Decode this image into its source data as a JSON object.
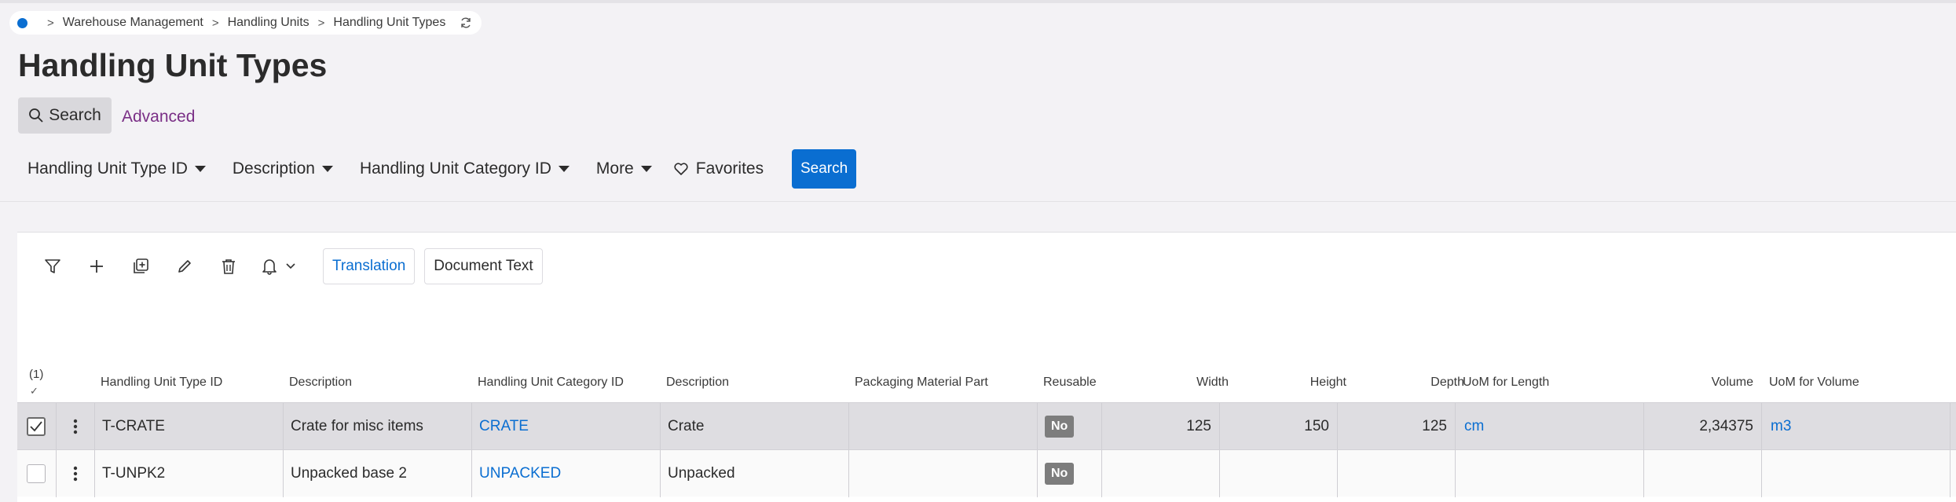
{
  "breadcrumb": {
    "items": [
      "Warehouse Management",
      "Handling Units",
      "Handling Unit Types"
    ]
  },
  "page": {
    "title": "Handling Unit Types"
  },
  "search": {
    "toggle_label": "Search",
    "advanced_label": "Advanced",
    "button_label": "Search"
  },
  "filters": [
    {
      "label": "Handling Unit Type ID"
    },
    {
      "label": "Description"
    },
    {
      "label": "Handling Unit Category ID"
    },
    {
      "label": "More"
    }
  ],
  "favorites_label": "Favorites",
  "toolbar": {
    "icons": [
      "filter-icon",
      "add-icon",
      "duplicate-icon",
      "edit-icon",
      "delete-icon",
      "bell-icon"
    ],
    "translation_label": "Translation",
    "document_text_label": "Document Text"
  },
  "table": {
    "selected_count": "(1)",
    "columns": [
      "Handling Unit Type ID",
      "Description",
      "Handling Unit Category ID",
      "Description",
      "Packaging Material Part",
      "Reusable",
      "Width",
      "Height",
      "Depth",
      "UoM for Length",
      "Volume",
      "UoM for Volume"
    ],
    "rows": [
      {
        "selected": true,
        "type_id": "T-CRATE",
        "description": "Crate for misc items",
        "category_id": "CRATE",
        "category_desc": "Crate",
        "packaging_part": "",
        "reusable": "No",
        "width": "125",
        "height": "150",
        "depth": "125",
        "uom_length": "cm",
        "volume": "2,34375",
        "uom_volume": "m3"
      },
      {
        "selected": false,
        "type_id": "T-UNPK2",
        "description": "Unpacked base 2",
        "category_id": "UNPACKED",
        "category_desc": "Unpacked",
        "packaging_part": "",
        "reusable": "No",
        "width": "",
        "height": "",
        "depth": "",
        "uom_length": "",
        "volume": "",
        "uom_volume": ""
      }
    ]
  },
  "colors": {
    "accent": "#0a6ed1",
    "advanced_link": "#7a2f86",
    "badge": "#7d7d7d",
    "selected_row": "#dedde1"
  }
}
